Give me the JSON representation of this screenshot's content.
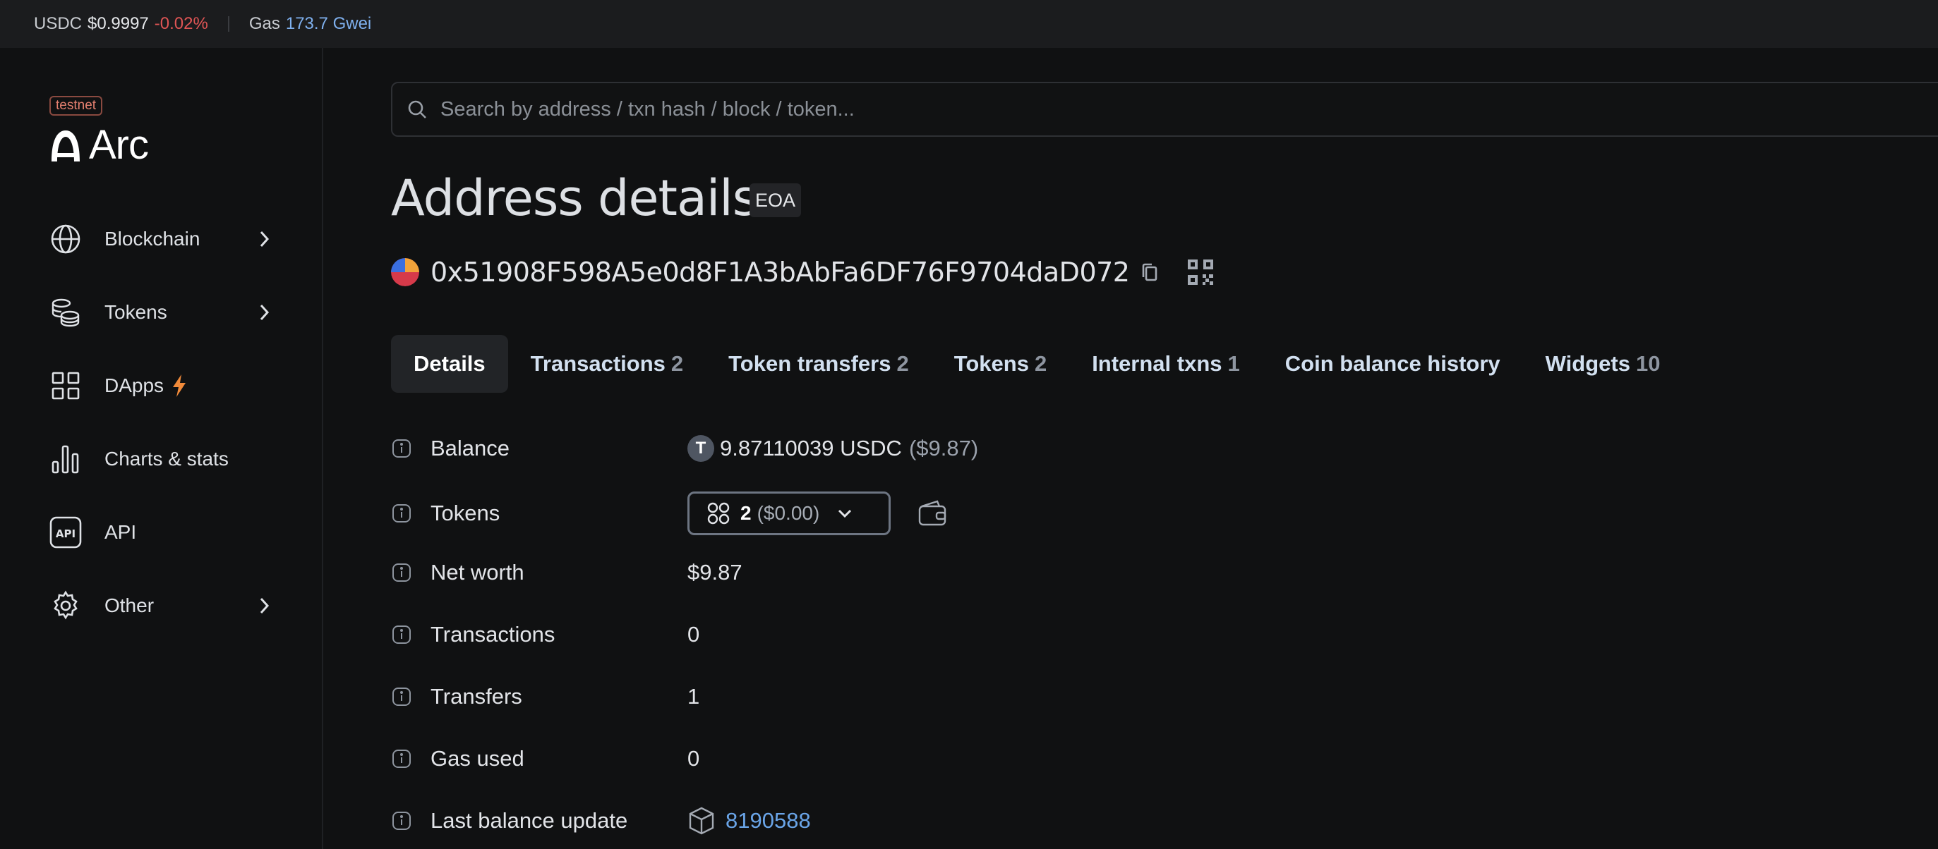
{
  "topbar": {
    "token": "USDC",
    "price": "$0.9997",
    "change": "-0.02%",
    "gas_label": "Gas",
    "gas_value": "173.7 Gwei"
  },
  "sidebar": {
    "badge": "testnet",
    "logo_text": "Arc",
    "items": [
      {
        "label": "Blockchain",
        "icon": "globe-icon",
        "has_chevron": true
      },
      {
        "label": "Tokens",
        "icon": "coins-icon",
        "has_chevron": true
      },
      {
        "label": "DApps",
        "icon": "grid-icon",
        "has_chevron": false
      },
      {
        "label": "Charts & stats",
        "icon": "bar-chart-icon",
        "has_chevron": false
      },
      {
        "label": "API",
        "icon": "api-icon",
        "has_chevron": false
      },
      {
        "label": "Other",
        "icon": "gear-icon",
        "has_chevron": true
      }
    ]
  },
  "search": {
    "placeholder": "Search by address / txn hash / block / token..."
  },
  "page": {
    "title": "Address details",
    "type_badge": "EOA",
    "address": "0x51908F598A5e0d8F1A3bAbFa6DF76F9704daD072"
  },
  "tabs": [
    {
      "label": "Details",
      "count": ""
    },
    {
      "label": "Transactions",
      "count": "2"
    },
    {
      "label": "Token transfers",
      "count": "2"
    },
    {
      "label": "Tokens",
      "count": "2"
    },
    {
      "label": "Internal txns",
      "count": "1"
    },
    {
      "label": "Coin balance history",
      "count": ""
    },
    {
      "label": "Widgets",
      "count": "10"
    }
  ],
  "details": {
    "balance_label": "Balance",
    "balance_coin_letter": "T",
    "balance_value": "9.87110039 USDC",
    "balance_usd": "($9.87)",
    "tokens_label": "Tokens",
    "tokens_count": "2",
    "tokens_usd": "($0.00)",
    "net_worth_label": "Net worth",
    "net_worth_value": "$9.87",
    "transactions_label": "Transactions",
    "transactions_value": "0",
    "transfers_label": "Transfers",
    "transfers_value": "1",
    "gas_used_label": "Gas used",
    "gas_used_value": "0",
    "last_balance_label": "Last balance update",
    "last_balance_value": "8190588"
  },
  "colors": {
    "background": "#101112",
    "accent_link": "#6aa5e8",
    "negative": "#e05555",
    "bolt": "#f08a3a"
  }
}
